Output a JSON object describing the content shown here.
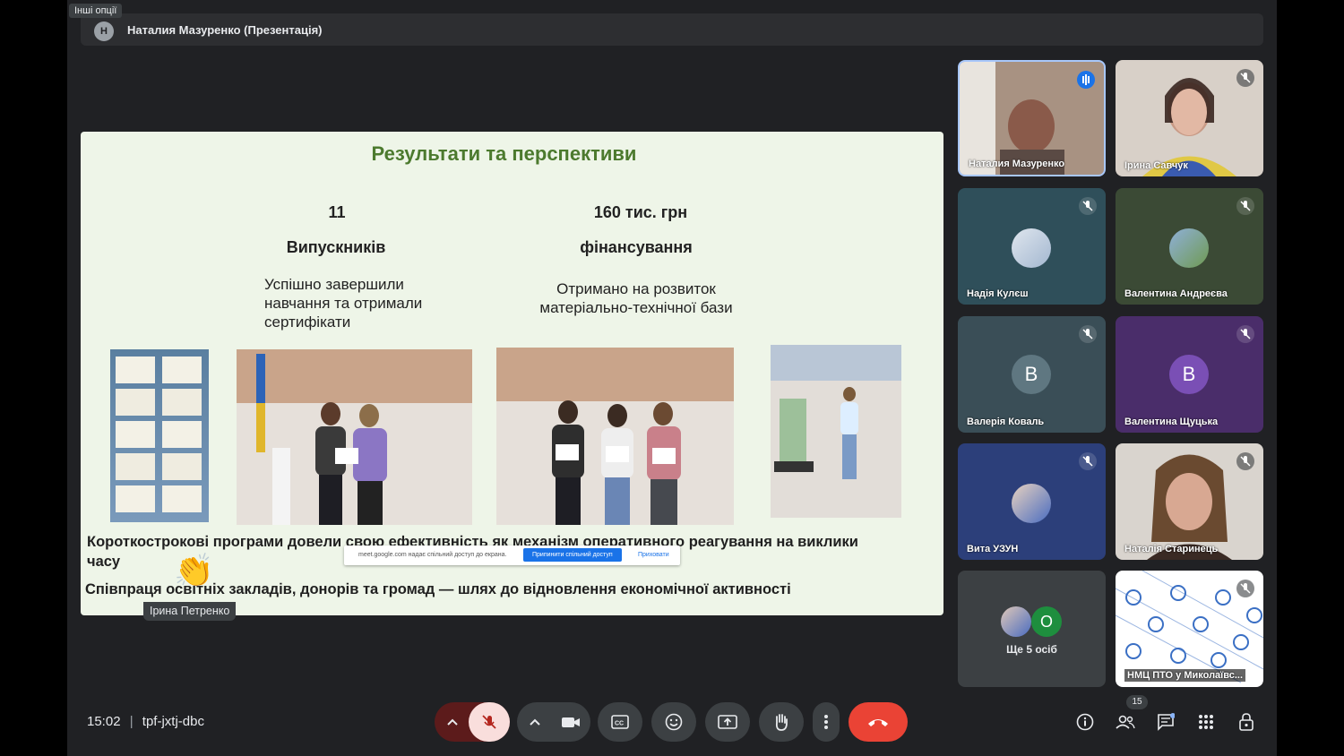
{
  "header": {
    "other_options": "Інші опції",
    "presenter_initial": "Н",
    "presenter_name": "Наталия Мазуренко (Презентація)"
  },
  "slide": {
    "title": "Результати та перспективи",
    "stat1_value": "11",
    "stat1_label": "Випускників",
    "stat1_desc": "Успішно завершили навчання та отримали сертифікати",
    "stat2_value": "160 тис. грн",
    "stat2_label": "фінансування",
    "stat2_desc": "Отримано на розвиток матеріально-технічної бази",
    "bottom_line1": "Короткострокові програми довели свою ефективність як механізм оперативного реагування на виклики часу",
    "bottom_line2": "Співпраця освітніх закладів, донорів та громад — шлях до відновлення економічної активності"
  },
  "share_bar": {
    "message": "meet.google.com надає спільний доступ до екрана.",
    "stop_label": "Припинити спільний доступ",
    "hide_label": "Приховати"
  },
  "reaction": {
    "emoji": "👏",
    "name": "Ірина Петренко"
  },
  "participants": [
    {
      "name": "Наталия Мазуренко",
      "kind": "video",
      "speaking": true
    },
    {
      "name": "Ірина Савчук",
      "kind": "video",
      "muted": true
    },
    {
      "name": "Надія Кулєш",
      "kind": "avatar",
      "muted": true
    },
    {
      "name": "Валентина Андреєва",
      "kind": "avatar",
      "muted": true
    },
    {
      "name": "Валерія Коваль",
      "kind": "letter",
      "initial": "В",
      "muted": true
    },
    {
      "name": "Валентина Щуцька",
      "kind": "letter",
      "initial": "В",
      "muted": true
    },
    {
      "name": "Вита УЗУН",
      "kind": "avatar",
      "muted": true
    },
    {
      "name": "Наталія Старинець",
      "kind": "video",
      "muted": true
    },
    {
      "name": "НМЦ ПТО у Миколаївс...",
      "kind": "video",
      "muted": true
    }
  ],
  "more_tile": {
    "initial": "О",
    "label": "Ще 5 осіб"
  },
  "meeting": {
    "time": "15:02",
    "separator": "|",
    "code": "tpf-jxtj-dbc",
    "participant_count": "15"
  },
  "colors": {
    "end_call": "#ea4335",
    "mic_off": "#f9dedc",
    "tile_teal": "#2f4f5a",
    "tile_olive": "#3b4a35",
    "tile_slate": "#3a4e57",
    "tile_purple": "#4a2d6a",
    "tile_blue": "#2c3f7a",
    "tile_grey": "#3c4043"
  },
  "icons": [
    "chevron-up-icon",
    "mic-off-icon",
    "camera-icon",
    "captions-icon",
    "emoji-icon",
    "present-icon",
    "raise-hand-icon",
    "more-vert-icon",
    "end-call-icon",
    "info-icon",
    "people-icon",
    "chat-icon",
    "activities-icon",
    "host-controls-icon"
  ]
}
